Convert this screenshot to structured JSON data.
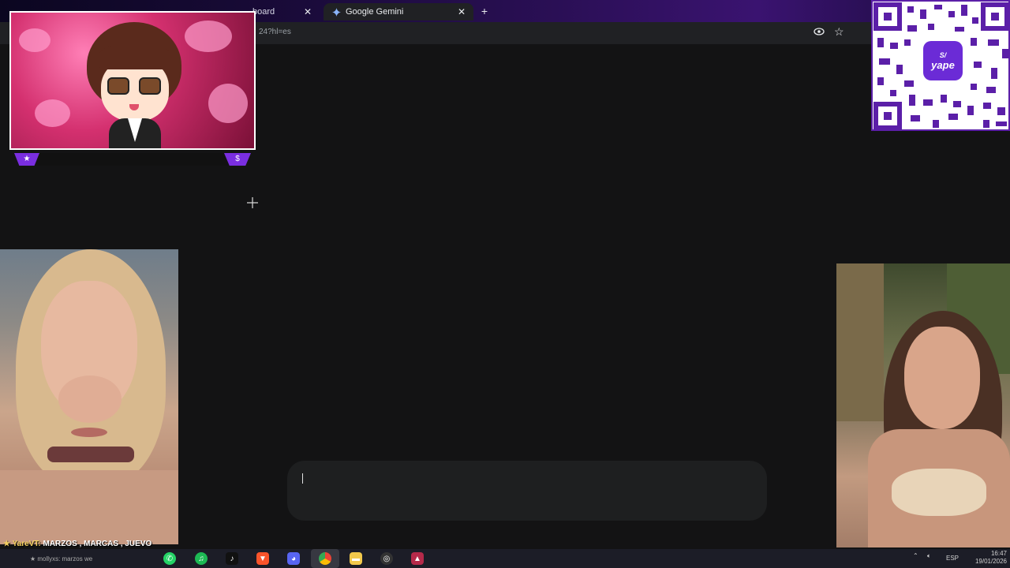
{
  "browser": {
    "tabs": [
      {
        "label": "board"
      },
      {
        "label": "Google Gemini"
      }
    ],
    "url": "24?hl=es"
  },
  "chat": {
    "user": "★ YareVT:",
    "message": "MARZOS , MARCAS , JUEVO",
    "next_line": "★ mollyxs: marzos we"
  },
  "taskbar": {
    "tray_language": "ESP",
    "clock_time": "16:47",
    "clock_date": "19/01/2026"
  },
  "overlays": {
    "qr_brand": "yape",
    "qr_currency": "S/"
  },
  "colors": {
    "accent_purple": "#7a2ee0",
    "background": "#131314",
    "prompt_bg": "#1e1f20"
  }
}
